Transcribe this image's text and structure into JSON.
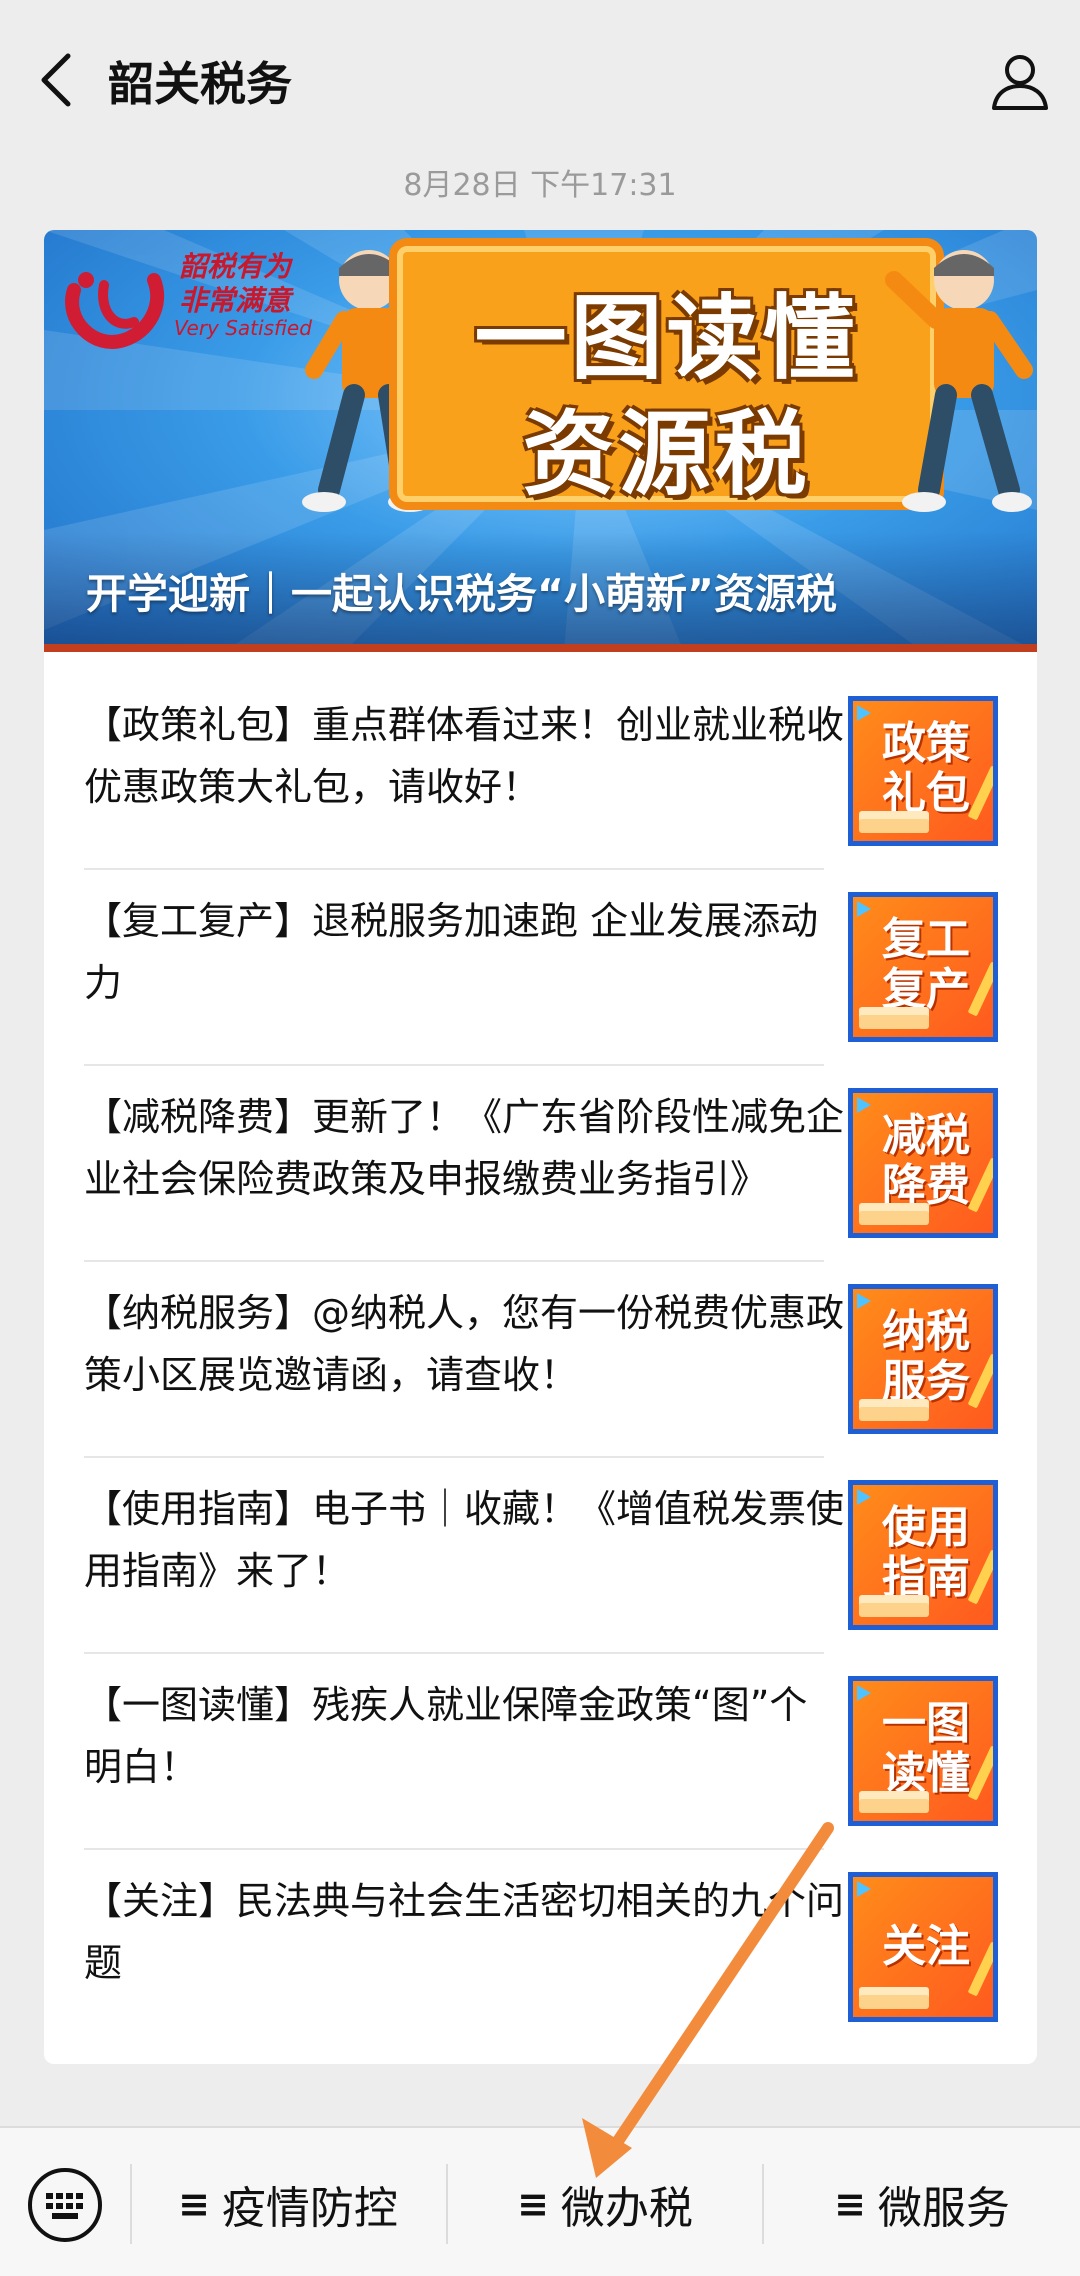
{
  "header": {
    "title": "韶关税务",
    "back_icon": "chevron-left-icon",
    "profile_icon": "person-icon"
  },
  "timestamp": "8月28日 下午17:31",
  "banner": {
    "logo_line1": "韶税有为",
    "logo_line2": "非常满意",
    "logo_sub": "Very Satisfied",
    "sign_line1": "一图读懂",
    "sign_line2": "资源税",
    "caption": "开学迎新｜一起认识税务“小萌新”资源税"
  },
  "articles": [
    {
      "text": "【政策礼包】重点群体看过来！创业就业税收优惠政策大礼包，请收好！",
      "thumb": [
        "政策",
        "礼包"
      ]
    },
    {
      "text": "【复工复产】退税服务加速跑 企业发展添动力",
      "thumb": [
        "复工",
        "复产"
      ]
    },
    {
      "text": "【减税降费】更新了！《广东省阶段性减免企业社会保险费政策及申报缴费业务指引》",
      "thumb": [
        "减税",
        "降费"
      ]
    },
    {
      "text": "【纳税服务】@纳税人，您有一份税费优惠政策小区展览邀请函，请查收！",
      "thumb": [
        "纳税",
        "服务"
      ]
    },
    {
      "text": "【使用指南】电子书｜收藏！《增值税发票使用指南》来了！",
      "thumb": [
        "使用",
        "指南"
      ]
    },
    {
      "text": "【一图读懂】残疾人就业保障金政策“图”个明白！",
      "thumb": [
        "一图",
        "读懂"
      ]
    },
    {
      "text": "【关注】民法典与社会生活密切相关的九个问题",
      "thumb": [
        "关注"
      ]
    }
  ],
  "bottom_menu": {
    "keyboard_icon": "keyboard-icon",
    "items": [
      {
        "icon": "≡",
        "label": "疫情防控"
      },
      {
        "icon": "≡",
        "label": "微办税"
      },
      {
        "icon": "≡",
        "label": "微服务"
      }
    ]
  },
  "colors": {
    "background": "#ededed",
    "thumb_orange": "#ff6a1f",
    "thumb_border": "#1e5fd6",
    "arrow": "#f28c3c"
  }
}
